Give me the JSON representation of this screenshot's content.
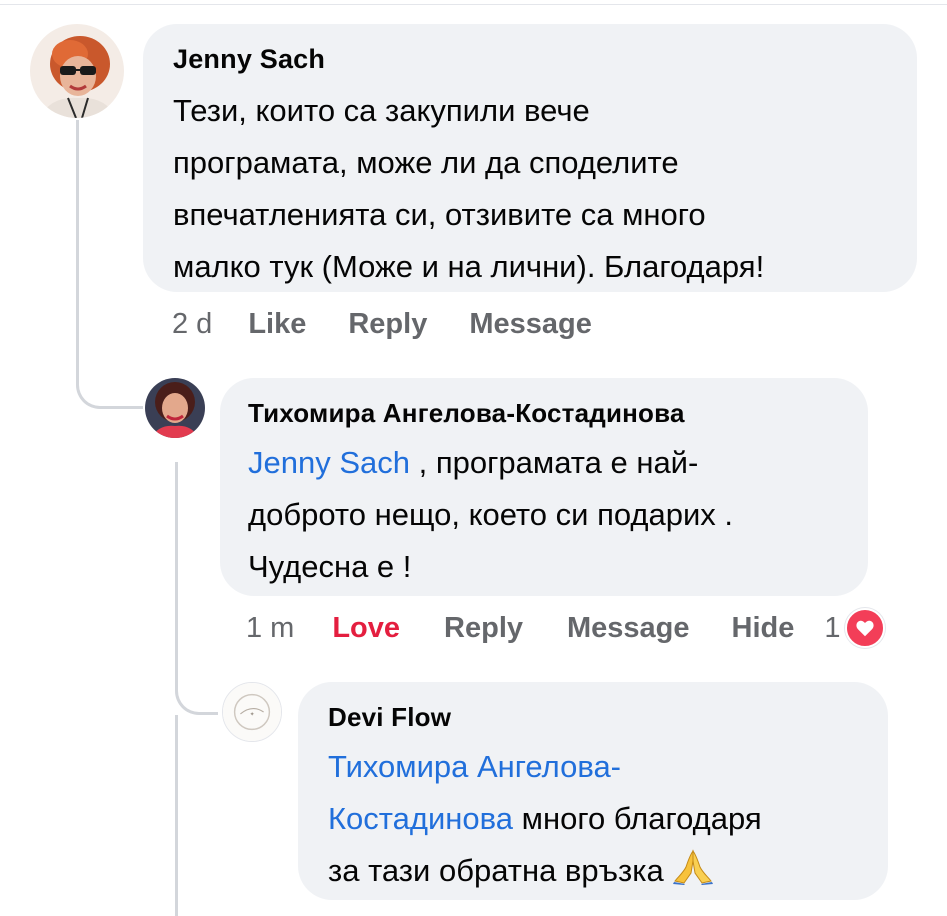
{
  "comments": [
    {
      "author": "Jenny Sach",
      "lines": [
        "Тези, които са закупили вече",
        "програмата, може ли да споделите",
        "впечатленията си, отзивите са много",
        "малко тук (Може и на лични). Благодаря!"
      ],
      "time": "2 d",
      "actions": {
        "like": "Like",
        "reply": "Reply",
        "message": "Message"
      }
    },
    {
      "author": "Тихомира Ангелова-Костадинова",
      "mention": "Jenny Sach",
      "line1_rest": " , програмата е най-",
      "line2": "доброто нещо, което си подарих .",
      "line3": "Чудесна е !",
      "time": "1 m",
      "actions": {
        "love": "Love",
        "reply": "Reply",
        "message": "Message",
        "hide": "Hide"
      },
      "reaction_count": "1",
      "reaction_icon": "heart-icon"
    },
    {
      "author": "Devi Flow",
      "mention_line1": "Тихомира Ангелова-",
      "mention_line2": "Костадинова",
      "line2_rest": " много благодаря",
      "line3": "за тази обратна връзка",
      "emoji": "praying-hands-icon"
    }
  ],
  "colors": {
    "bubble": "#f0f2f5",
    "mention": "#216fdb",
    "action_text": "#65676b",
    "love": "#e41e3f",
    "reaction_heart": "#f33e58",
    "thread_line": "#d3d6db"
  }
}
